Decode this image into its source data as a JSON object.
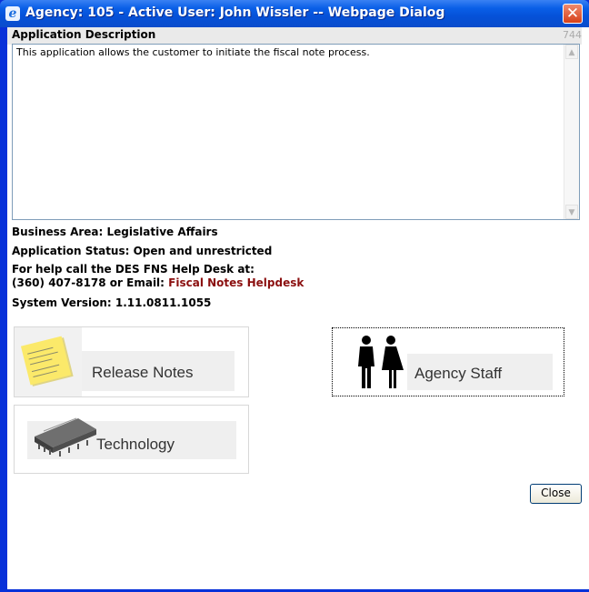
{
  "window": {
    "title": "Agency: 105 - Active User: John Wissler -- Webpage Dialog",
    "close_glyph": "✕"
  },
  "description": {
    "heading": "Application Description",
    "counter": "744",
    "text": "This application allows the customer to initiate the fiscal note process."
  },
  "info": {
    "business_area": "Business Area: Legislative Affairs",
    "status": "Application Status: Open and unrestricted",
    "help_line1": "For help call the DES FNS Help Desk at:",
    "help_line2_prefix": "(360) 407-8178 or Email: ",
    "helpdesk_link": "Fiscal Notes Helpdesk",
    "version": "System Version: 1.11.0811.1055"
  },
  "tiles": {
    "release_notes": "Release Notes",
    "agency_staff": "Agency Staff",
    "technology": "Technology"
  },
  "buttons": {
    "close": "Close"
  },
  "colors": {
    "titlebar": "#0a5fe7",
    "link": "#8b1010"
  }
}
